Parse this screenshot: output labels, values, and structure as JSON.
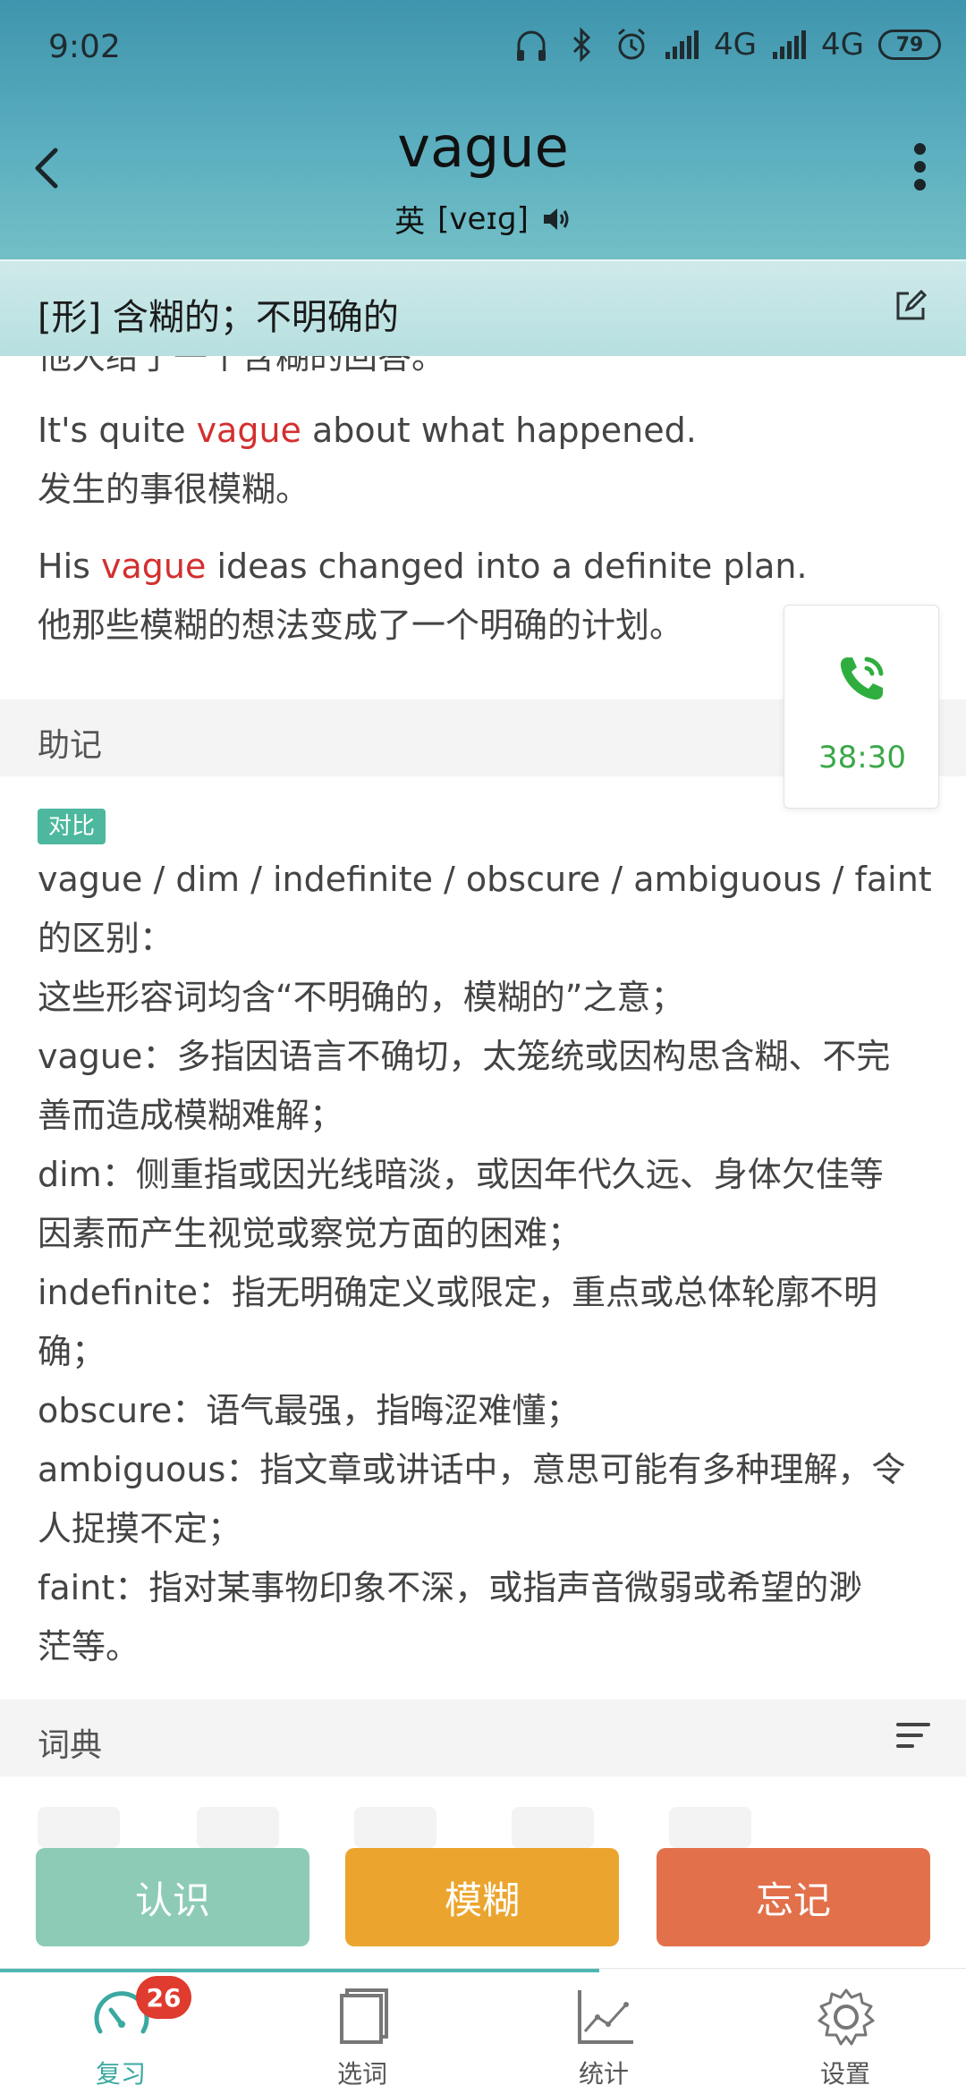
{
  "status_bar": {
    "time": "9:02",
    "network_1": "4G",
    "network_2": "4G",
    "battery": "79"
  },
  "header": {
    "word": "vague",
    "phonetic_label": "英",
    "phonetic": "[veɪɡ]"
  },
  "definition": {
    "text": "[形] 含糊的；不明确的"
  },
  "examples": {
    "cut_line": "他大给了一个含糊的回答。",
    "items": [
      {
        "en_before": "It's quite ",
        "en_highlight": "vague",
        "en_after": " about what happened.",
        "zh": "发生的事很模糊。"
      },
      {
        "en_before": "His ",
        "en_highlight": "vague",
        "en_after": " ideas changed into a definite plan.",
        "zh": "他那些模糊的想法变成了一个明确的计划。"
      }
    ]
  },
  "mnemonic": {
    "section_label": "助记",
    "tag": "对比",
    "lines": [
      "vague / dim / indefinite / obscure / ambiguous / faint",
      "的区别：",
      "这些形容词均含“不明确的，模糊的”之意；",
      "vague：多指因语言不确切，太笼统或因构思含糊、不完",
      "善而造成模糊难解；",
      "dim：侧重指或因光线暗淡，或因年代久远、身体欠佳等",
      "因素而产生视觉或察觉方面的困难；",
      "indefinite：指无明确定义或限定，重点或总体轮廓不明",
      "确；",
      "obscure：语气最强，指晦涩难懂；",
      "ambiguous：指文章或讲话中，意思可能有多种理解，令",
      "人捉摸不定；",
      "faint：指对某事物印象不深，或指声音微弱或希望的渺",
      "茫等。"
    ]
  },
  "dictionary": {
    "section_label": "词典"
  },
  "call_widget": {
    "time": "38:30",
    "color": "#3aa848"
  },
  "actions": {
    "know": "认识",
    "vague": "模糊",
    "forget": "忘记"
  },
  "tabs": [
    {
      "label": "复习",
      "icon": "review-gauge-icon",
      "badge": "26",
      "active": true
    },
    {
      "label": "选词",
      "icon": "book-icon"
    },
    {
      "label": "统计",
      "icon": "chart-icon"
    },
    {
      "label": "设置",
      "icon": "gear-icon"
    }
  ],
  "colors": {
    "header_top": "#3f95ad",
    "highlight": "#d32f2f",
    "know": "#8dcbb6",
    "vague": "#eba52e",
    "forget": "#e2704a",
    "accent": "#3aa9a0"
  }
}
